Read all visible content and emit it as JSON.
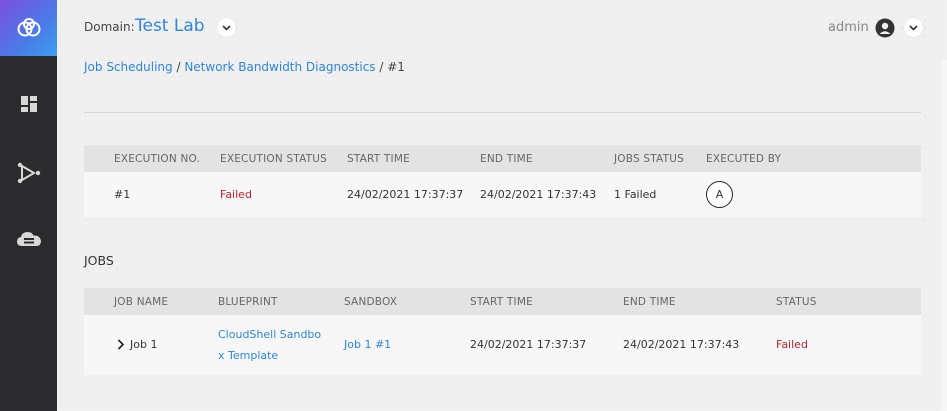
{
  "header": {
    "domain_label": "Domain:",
    "domain_value": "Test Lab",
    "user_name": "admin"
  },
  "sidebar": {
    "items": [
      {
        "icon": "logo-icon"
      },
      {
        "icon": "dashboard-icon"
      },
      {
        "icon": "blueprint-icon"
      },
      {
        "icon": "cloud-icon"
      }
    ]
  },
  "breadcrumb": {
    "item1": "Job Scheduling",
    "sep1": " / ",
    "item2": "Network Bandwidth Diagnostics",
    "sep2": " / ",
    "current": "#1"
  },
  "execution_table": {
    "headers": [
      "EXECUTION NO.",
      "EXECUTION STATUS",
      "START TIME",
      "END TIME",
      "JOBS STATUS",
      "EXECUTED BY"
    ],
    "row": {
      "number": "#1",
      "status": "Failed",
      "start_time": "24/02/2021 17:37:37",
      "end_time": "24/02/2021 17:37:43",
      "jobs_status": "1 Failed",
      "executed_by_initial": "A"
    }
  },
  "jobs_section": {
    "title": "JOBS",
    "headers": [
      "JOB NAME",
      "BLUEPRINT",
      "SANDBOX",
      "START TIME",
      "END TIME",
      "STATUS"
    ],
    "rows": [
      {
        "name": "Job 1",
        "blueprint_line1": "CloudShell Sandbo",
        "blueprint_line2": "x Template",
        "sandbox": "Job 1 #1",
        "start_time": "24/02/2021 17:37:37",
        "end_time": "24/02/2021 17:37:43",
        "status": "Failed"
      }
    ]
  },
  "colors": {
    "accent": "#2f86d6",
    "failed": "#b3262f",
    "sidebar": "#2b2b2e"
  }
}
